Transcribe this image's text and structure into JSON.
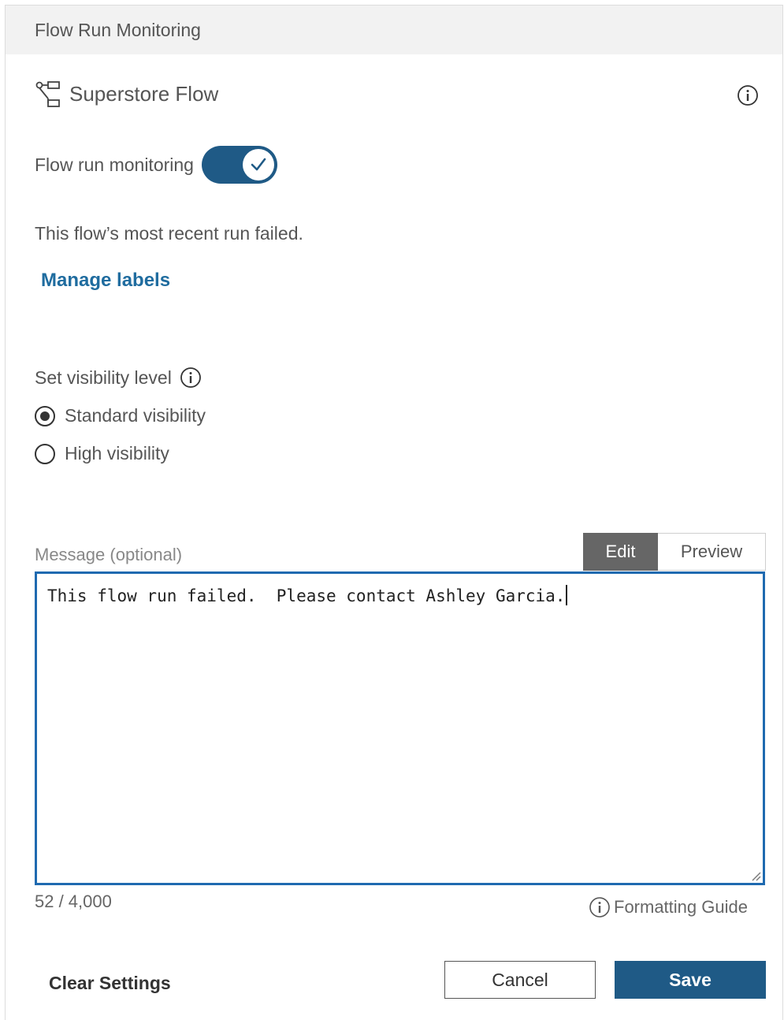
{
  "header": {
    "title": "Flow Run Monitoring"
  },
  "flow": {
    "name": "Superstore Flow",
    "icon": "flow-icon"
  },
  "monitoring": {
    "label": "Flow run monitoring",
    "enabled": true,
    "accent_color": "#1f5a86"
  },
  "status": {
    "text": "This flow’s most recent run failed."
  },
  "links": {
    "manage_labels": "Manage labels"
  },
  "visibility": {
    "label": "Set visibility level",
    "options": [
      {
        "label": "Standard visibility",
        "selected": true
      },
      {
        "label": "High visibility",
        "selected": false
      }
    ]
  },
  "message": {
    "label": "Message (optional)",
    "tabs": {
      "edit": "Edit",
      "preview": "Preview",
      "active": "Edit"
    },
    "value": "This flow run failed.  Please contact Ashley Garcia.",
    "char_count": "52 / 4,000",
    "formatting_guide": "Formatting Guide",
    "border_color": "#1f6ab0"
  },
  "footer": {
    "clear": "Clear Settings",
    "cancel": "Cancel",
    "save": "Save"
  }
}
